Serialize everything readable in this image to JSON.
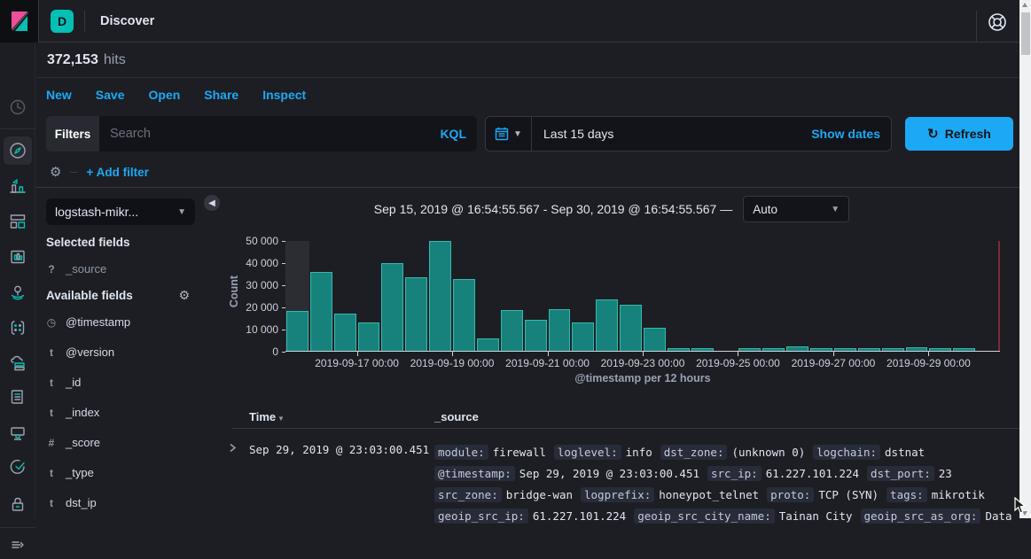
{
  "app": {
    "title": "Discover",
    "badge": "D",
    "hits_count": "372,153",
    "hits_label": "hits"
  },
  "nav_rail": {
    "items": [
      "recently-viewed-icon",
      "discover-icon",
      "visualize-icon",
      "dashboard-icon",
      "canvas-icon",
      "maps-icon",
      "machine-learning-icon",
      "metrics-icon",
      "logs-icon",
      "apm-icon",
      "uptime-icon",
      "siem-icon",
      "collapse-menu-icon"
    ]
  },
  "nav_links": [
    "New",
    "Save",
    "Open",
    "Share",
    "Inspect"
  ],
  "search": {
    "filters_label": "Filters",
    "placeholder": "Search",
    "language": "KQL"
  },
  "timepicker": {
    "range": "Last 15 days",
    "show_dates": "Show dates",
    "refresh_label": "Refresh"
  },
  "filter_bar": {
    "add_filter": "+ Add filter"
  },
  "sidebar": {
    "index_pattern": "logstash-mikr...",
    "selected_heading": "Selected fields",
    "selected_fields": [
      {
        "type": "?",
        "name": "_source"
      }
    ],
    "available_heading": "Available fields",
    "available_fields": [
      {
        "type": "clock",
        "name": "@timestamp"
      },
      {
        "type": "t",
        "name": "@version"
      },
      {
        "type": "t",
        "name": "_id"
      },
      {
        "type": "t",
        "name": "_index"
      },
      {
        "type": "#",
        "name": "_score"
      },
      {
        "type": "t",
        "name": "_type"
      },
      {
        "type": "t",
        "name": "dst_ip"
      }
    ]
  },
  "chart_header": {
    "range_label": "Sep 15, 2019 @ 16:54:55.567 - Sep 30, 2019 @ 16:54:55.567 —",
    "interval": "Auto"
  },
  "chart_data": {
    "type": "bar",
    "title": "Sep 15, 2019 @ 16:54:55.567 - Sep 30, 2019 @ 16:54:55.567",
    "ylabel": "Count",
    "xlabel": "@timestamp per 12 hours",
    "ylim": [
      0,
      50000
    ],
    "ytick_labels": [
      "0",
      "10 000",
      "20 000",
      "30 000",
      "40 000",
      "50 000"
    ],
    "bucket_interval_hours": 12,
    "x_start": "2019-09-15 16:54",
    "x_end": "2019-09-30 16:54",
    "values": [
      18000,
      35500,
      16800,
      12800,
      39800,
      33200,
      49800,
      32500,
      5500,
      18300,
      14000,
      18700,
      12900,
      23200,
      20800,
      10300,
      1200,
      1200,
      0,
      1200,
      1200,
      2200,
      1100,
      1200,
      1200,
      1100,
      1500,
      1100,
      1200,
      0
    ],
    "xticks": [
      {
        "label": "2019-09-17 00:00",
        "frac": 0.1
      },
      {
        "label": "2019-09-19 00:00",
        "frac": 0.2333
      },
      {
        "label": "2019-09-21 00:00",
        "frac": 0.3667
      },
      {
        "label": "2019-09-23 00:00",
        "frac": 0.5
      },
      {
        "label": "2019-09-25 00:00",
        "frac": 0.6333
      },
      {
        "label": "2019-09-27 00:00",
        "frac": 0.7667
      },
      {
        "label": "2019-09-29 00:00",
        "frac": 0.9
      }
    ],
    "bar_color": "#17827c",
    "partial_bucket_index": 0,
    "end_marker_color": "#7d2b31",
    "grid": false,
    "legend": "none"
  },
  "table": {
    "headers": [
      "Time",
      "_source"
    ],
    "rows": [
      {
        "time": "Sep 29, 2019 @ 23:03:00.451",
        "source_lines": [
          [
            {
              "k": "module:",
              "v": "firewall"
            },
            {
              "k": "loglevel:",
              "v": "info"
            },
            {
              "k": "dst_zone:",
              "v": "(unknown 0)"
            },
            {
              "k": "logchain:",
              "v": "dstnat"
            }
          ],
          [
            {
              "k": "@timestamp:",
              "v": "Sep 29, 2019 @ 23:03:00.451"
            },
            {
              "k": "src_ip:",
              "v": "61.227.101.224"
            },
            {
              "k": "dst_port:",
              "v": "23"
            }
          ],
          [
            {
              "k": "src_zone:",
              "v": "bridge-wan"
            },
            {
              "k": "logprefix:",
              "v": "honeypot_telnet"
            },
            {
              "k": "proto:",
              "v": "TCP (SYN)"
            },
            {
              "k": "tags:",
              "v": "mikrotik"
            }
          ],
          [
            {
              "k": "geoip_src_ip:",
              "v": "61.227.101.224"
            },
            {
              "k": "geoip_src_city_name:",
              "v": "Tainan City"
            },
            {
              "k": "geoip_src_as_org:",
              "v": "Data"
            }
          ]
        ]
      }
    ]
  },
  "colors": {
    "accent_blue": "#1ba9f5",
    "brand_teal": "#00bfb3",
    "bar_teal": "#17827c",
    "background": "#1d1e24"
  }
}
